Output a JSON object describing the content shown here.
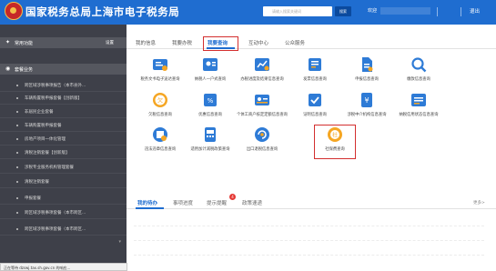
{
  "header": {
    "title": "国家税务总局上海市电子税务局",
    "search_placeholder": "请输入搜索关键词",
    "search_button": "搜索",
    "welcome": "欢迎",
    "exit": "退出",
    "brand_color": "#1f6dd0"
  },
  "sidebar": {
    "common_title": "常用功能",
    "common_settings": "设置",
    "business_title": "套餐业务",
    "items": [
      {
        "label": "跨区域涉税事项报告（本市县外..."
      },
      {
        "label": "车辆购置税申报套餐【创新版】"
      },
      {
        "label": "非居民企业套餐"
      },
      {
        "label": "车辆购置税申报套餐"
      },
      {
        "label": "房地产项目一体化管理"
      },
      {
        "label": "清税注销套餐【创新版】"
      },
      {
        "label": "涉税专业服务机构管理套餐"
      },
      {
        "label": "清税注销套餐"
      },
      {
        "label": "申报套餐"
      },
      {
        "label": "跨区域涉税事项套餐（本市跨区..."
      },
      {
        "label": "跨区域涉税事项套餐（本市跨区..."
      }
    ]
  },
  "main": {
    "tabs": [
      "我的信息",
      "我要办税",
      "我要查询",
      "互动中心",
      "公众服务"
    ],
    "active_tab": "我要查询",
    "query_items": [
      {
        "label": "税务文书电子送达查询",
        "icon": "document-delivery-icon"
      },
      {
        "label": "纳税人一户式查询",
        "icon": "taxpayer-profile-icon"
      },
      {
        "label": "办税进度及结果信息查询",
        "icon": "progress-result-icon"
      },
      {
        "label": "发票信息查询",
        "icon": "invoice-icon"
      },
      {
        "label": "申报信息查询",
        "icon": "declaration-icon"
      },
      {
        "label": "缴款信息查询",
        "icon": "payment-search-icon"
      },
      {
        "label": "欠税信息查询",
        "icon": "tax-arrears-icon"
      },
      {
        "label": "优惠信息查询",
        "icon": "preferential-icon"
      },
      {
        "label": "个体工商户核定定额信息查询",
        "icon": "individual-business-icon"
      },
      {
        "label": "证明信息查询",
        "icon": "certificate-icon"
      },
      {
        "label": "涉税中介机构信息查询",
        "icon": "intermediary-icon"
      },
      {
        "label": "纳税信用状态信息查询",
        "icon": "credit-status-icon"
      },
      {
        "label": "违法违章信息查询",
        "icon": "violation-icon"
      },
      {
        "label": "适用加计减税政策查询",
        "icon": "tax-policy-icon"
      },
      {
        "label": "出口退税信息查询",
        "icon": "export-rebate-icon"
      },
      {
        "label": "社保费查询",
        "icon": "social-insurance-icon"
      }
    ],
    "highlighted_item": "社保费查询",
    "bottom_tabs": [
      "我的待办",
      "事项进度",
      "提示提醒",
      "政策速递"
    ],
    "badge_count": "4",
    "more_label": "更多>"
  },
  "status_bar": {
    "text": "正在等待 dzswj.tax.sh.gov.cn 的响应..."
  }
}
